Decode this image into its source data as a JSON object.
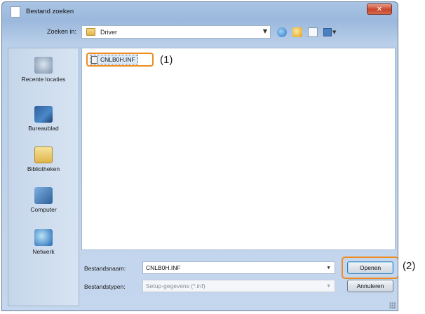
{
  "window": {
    "title": "Bestand zoeken",
    "close_symbol": "✕"
  },
  "lookin": {
    "label": "Zoeken in:",
    "value": "Driver"
  },
  "places": [
    {
      "label": "Recente locaties",
      "icon": "recent-locations-icon"
    },
    {
      "label": "Bureaublad",
      "icon": "desktop-icon"
    },
    {
      "label": "Bibliotheken",
      "icon": "libraries-icon"
    },
    {
      "label": "Computer",
      "icon": "computer-icon"
    },
    {
      "label": "Netwerk",
      "icon": "network-icon"
    }
  ],
  "files": [
    {
      "name": "CNLB0H.INF",
      "icon": "inf-file-icon"
    }
  ],
  "bottom": {
    "filename_label": "Bestandsnaam:",
    "filename_value": "CNLB0H.INF",
    "filetype_label": "Bestandstypen:",
    "filetype_value": "Setup-gegevens (*.inf)",
    "open_label": "Openen",
    "cancel_label": "Annuleren"
  },
  "callouts": {
    "one": "(1)",
    "two": "(2)"
  },
  "colors": {
    "highlight": "#ee8c21",
    "close_button": "#c9452b"
  }
}
